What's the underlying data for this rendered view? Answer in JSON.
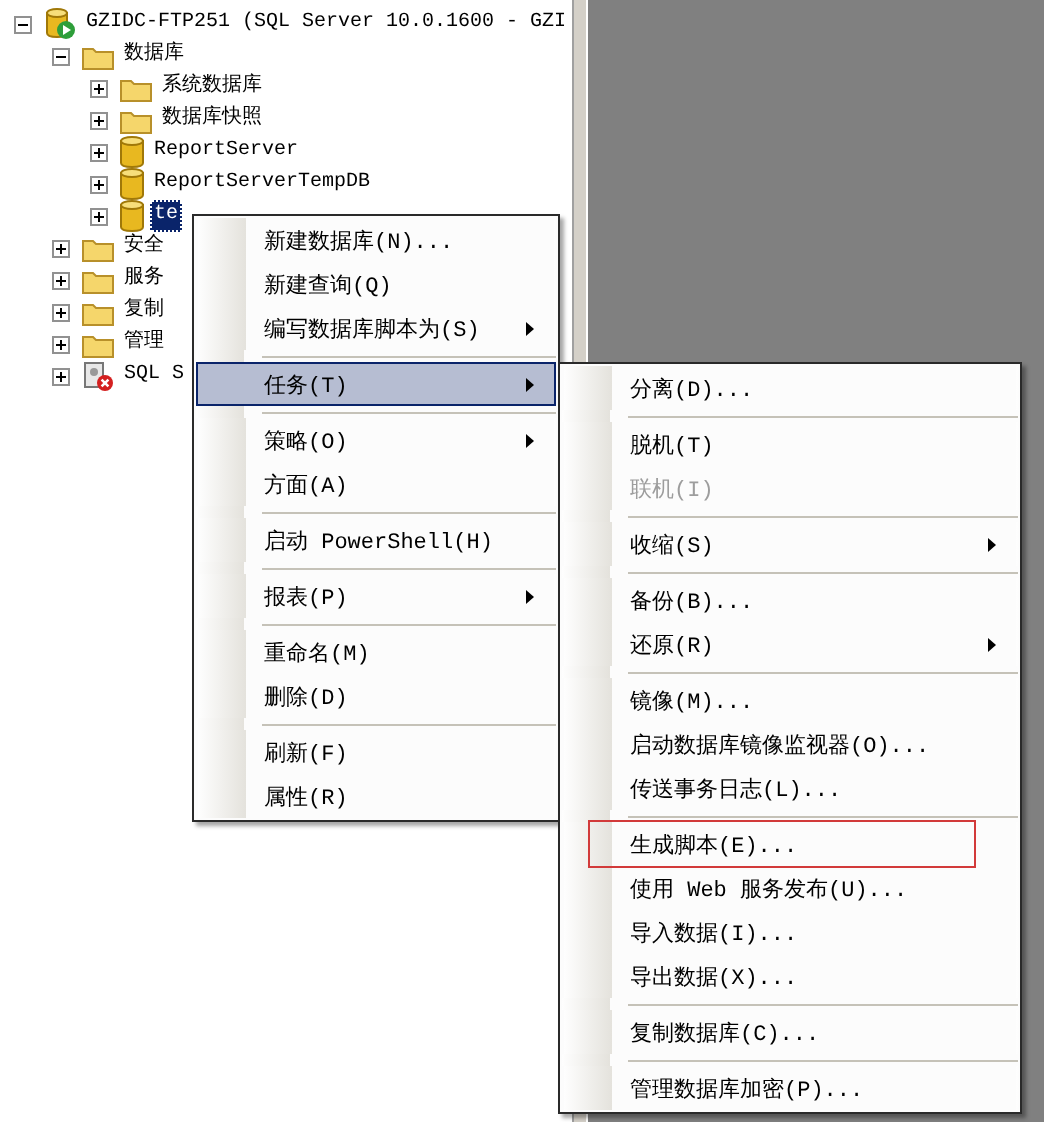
{
  "tree": {
    "label": "GZIDC-FTP251 (SQL Server 10.0.1600 - GZI",
    "kind": "server",
    "expanded": true,
    "selected": false,
    "children": [
      {
        "label": "数据库",
        "kind": "folder",
        "expanded": true,
        "selected": false,
        "children": [
          {
            "label": "系统数据库",
            "kind": "folder",
            "expanded": false,
            "selected": false
          },
          {
            "label": "数据库快照",
            "kind": "folder",
            "expanded": false,
            "selected": false
          },
          {
            "label": "ReportServer",
            "kind": "database",
            "expanded": false,
            "selected": false
          },
          {
            "label": "ReportServerTempDB",
            "kind": "database",
            "expanded": false,
            "selected": false
          },
          {
            "label": "te",
            "kind": "database",
            "expanded": false,
            "selected": true
          }
        ]
      },
      {
        "label": "安全",
        "kind": "folder",
        "expanded": false,
        "selected": false
      },
      {
        "label": "服务",
        "kind": "folder",
        "expanded": false,
        "selected": false
      },
      {
        "label": "复制",
        "kind": "folder",
        "expanded": false,
        "selected": false
      },
      {
        "label": "管理",
        "kind": "folder",
        "expanded": false,
        "selected": false
      },
      {
        "label": "SQL S",
        "kind": "agent",
        "expanded": false,
        "selected": false
      }
    ]
  },
  "context_menu": {
    "items": [
      {
        "kind": "item",
        "label": "新建数据库(N)...",
        "selected": false,
        "submenu": false
      },
      {
        "kind": "item",
        "label": "新建查询(Q)",
        "selected": false,
        "submenu": false
      },
      {
        "kind": "item",
        "label": "编写数据库脚本为(S)",
        "selected": false,
        "submenu": true
      },
      {
        "kind": "separator"
      },
      {
        "kind": "item",
        "label": "任务(T)",
        "selected": true,
        "submenu": true
      },
      {
        "kind": "separator"
      },
      {
        "kind": "item",
        "label": "策略(O)",
        "selected": false,
        "submenu": true
      },
      {
        "kind": "item",
        "label": "方面(A)",
        "selected": false,
        "submenu": false
      },
      {
        "kind": "separator"
      },
      {
        "kind": "item",
        "label": "启动 PowerShell(H)",
        "selected": false,
        "submenu": false
      },
      {
        "kind": "separator"
      },
      {
        "kind": "item",
        "label": "报表(P)",
        "selected": false,
        "submenu": true
      },
      {
        "kind": "separator"
      },
      {
        "kind": "item",
        "label": "重命名(M)",
        "selected": false,
        "submenu": false
      },
      {
        "kind": "item",
        "label": "删除(D)",
        "selected": false,
        "submenu": false
      },
      {
        "kind": "separator"
      },
      {
        "kind": "item",
        "label": "刷新(F)",
        "selected": false,
        "submenu": false
      },
      {
        "kind": "item",
        "label": "属性(R)",
        "selected": false,
        "submenu": false
      }
    ]
  },
  "task_menu": {
    "items": [
      {
        "kind": "item",
        "label": "分离(D)...",
        "disabled": false,
        "submenu": false,
        "highlighted": false
      },
      {
        "kind": "separator"
      },
      {
        "kind": "item",
        "label": "脱机(T)",
        "disabled": false,
        "submenu": false,
        "highlighted": false
      },
      {
        "kind": "item",
        "label": "联机(I)",
        "disabled": true,
        "submenu": false,
        "highlighted": false
      },
      {
        "kind": "separator"
      },
      {
        "kind": "item",
        "label": "收缩(S)",
        "disabled": false,
        "submenu": true,
        "highlighted": false
      },
      {
        "kind": "separator"
      },
      {
        "kind": "item",
        "label": "备份(B)...",
        "disabled": false,
        "submenu": false,
        "highlighted": false
      },
      {
        "kind": "item",
        "label": "还原(R)",
        "disabled": false,
        "submenu": true,
        "highlighted": false
      },
      {
        "kind": "separator"
      },
      {
        "kind": "item",
        "label": "镜像(M)...",
        "disabled": false,
        "submenu": false,
        "highlighted": false
      },
      {
        "kind": "item",
        "label": "启动数据库镜像监视器(O)...",
        "disabled": false,
        "submenu": false,
        "highlighted": false
      },
      {
        "kind": "item",
        "label": "传送事务日志(L)...",
        "disabled": false,
        "submenu": false,
        "highlighted": false
      },
      {
        "kind": "separator"
      },
      {
        "kind": "item",
        "label": "生成脚本(E)...",
        "disabled": false,
        "submenu": false,
        "highlighted": true
      },
      {
        "kind": "item",
        "label": "使用 Web 服务发布(U)...",
        "disabled": false,
        "submenu": false,
        "highlighted": false
      },
      {
        "kind": "item",
        "label": "导入数据(I)...",
        "disabled": false,
        "submenu": false,
        "highlighted": false
      },
      {
        "kind": "item",
        "label": "导出数据(X)...",
        "disabled": false,
        "submenu": false,
        "highlighted": false
      },
      {
        "kind": "separator"
      },
      {
        "kind": "item",
        "label": "复制数据库(C)...",
        "disabled": false,
        "submenu": false,
        "highlighted": false
      },
      {
        "kind": "separator"
      },
      {
        "kind": "item",
        "label": "管理数据库加密(P)...",
        "disabled": false,
        "submenu": false,
        "highlighted": false
      }
    ]
  }
}
